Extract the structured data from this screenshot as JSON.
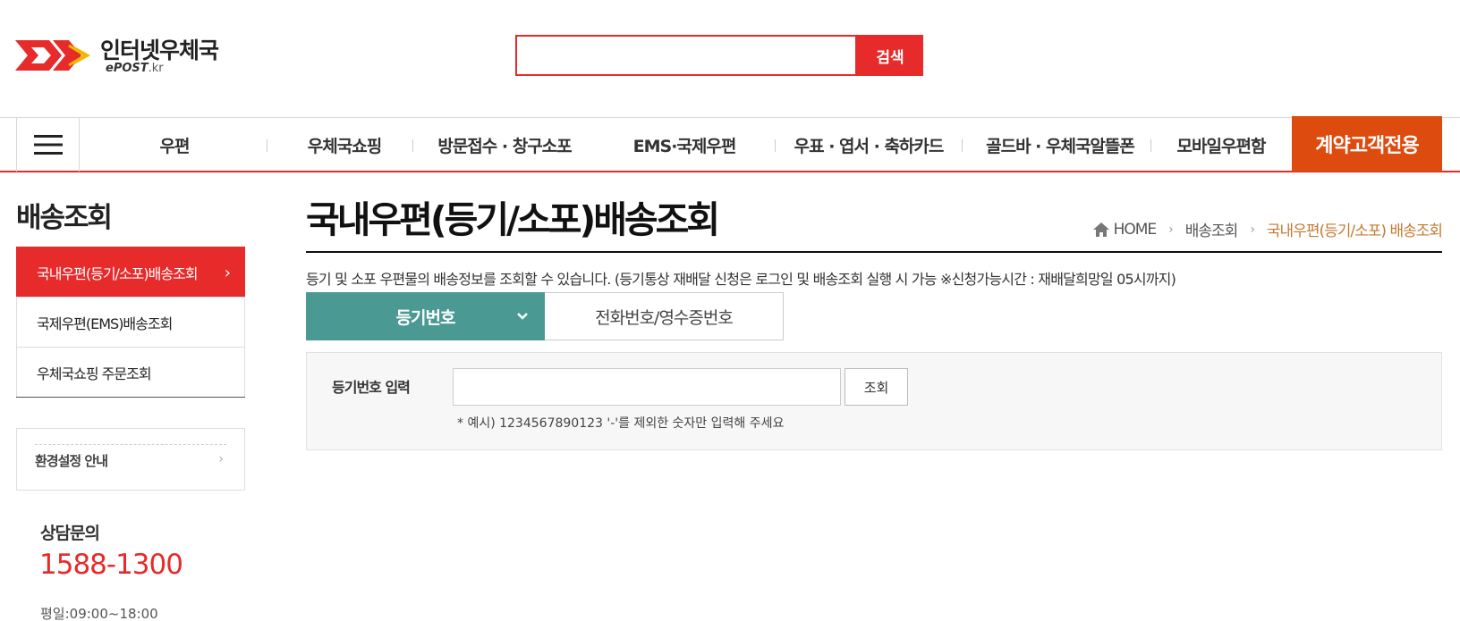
{
  "header": {
    "logo_kr": "인터넷우체국",
    "logo_en": "ePOST",
    "logo_en_suffix": ".kr",
    "search_placeholder": "",
    "search_button": "검색"
  },
  "gnb": {
    "items": [
      "우편",
      "우체국쇼핑",
      "방문접수 · 창구소포",
      "EMS·국제우편",
      "우표 · 엽서 · 축하카드",
      "골드바 · 우체국알뜰폰",
      "모바일우편함"
    ],
    "special": "계약고객전용"
  },
  "sidebar": {
    "title": "배송조회",
    "items": [
      {
        "label": "국내우편(등기/소포)배송조회",
        "active": true
      },
      {
        "label": "국제우편(EMS)배송조회",
        "active": false
      },
      {
        "label": "우체국쇼핑 주문조회",
        "active": false
      }
    ],
    "settings_label": "환경설정 안내",
    "consult_title": "상담문의",
    "consult_phone": "1588-1300",
    "consult_hours": "평일:09:00~18:00"
  },
  "content": {
    "title": "국내우편(등기/소포)배송조회",
    "breadcrumb": [
      "HOME",
      "배송조회",
      "국내우편(등기/소포) 배송조회"
    ],
    "description": "등기 및 소포 우편물의 배송정보를 조회할 수 있습니다. (등기통상 재배달 신청은 로그인 및 배송조회 실행 시 가능 ※신청가능시간 : 재배달희망일 05시까지)",
    "tab_active": "등기번호",
    "tab_inactive": "전화번호/영수증번호",
    "form_label": "등기번호 입력",
    "input_value": "",
    "input_placeholder": "",
    "submit_button": "조회",
    "hint": "* 예시) 1234567890123 '-'를 제외한 숫자만 입력해 주세요"
  },
  "colors": {
    "brand_red": "#e72a2a",
    "tab_teal": "#4a9993",
    "special_orange": "#dd4b0e",
    "breadcrumb_current": "#c37a30"
  },
  "icons": [
    "epost-logo",
    "search-icon",
    "hamburger-menu-icon",
    "home-icon",
    "chevron-right-icon",
    "chevron-down-icon"
  ]
}
